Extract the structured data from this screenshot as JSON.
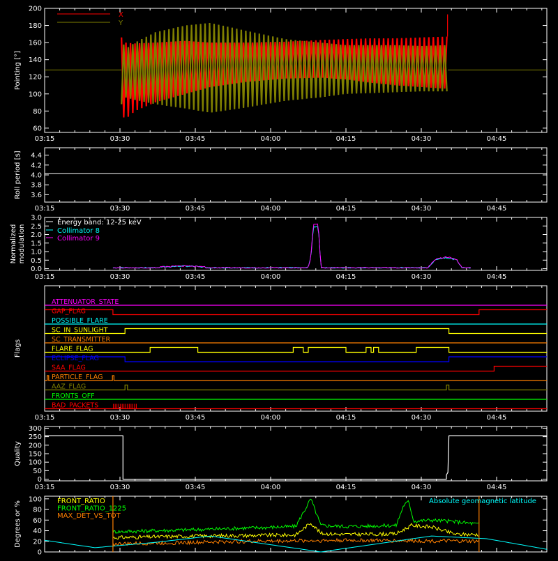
{
  "chart_data": [
    {
      "id": "pointing",
      "type": "line",
      "ylabel": "Pointing [°]",
      "x_tick_labels": [
        "03:15",
        "03:30",
        "03:45",
        "04:00",
        "04:15",
        "04:30",
        "04:45"
      ],
      "ylim": [
        55,
        200
      ],
      "y_tick_labels": [
        "60",
        "80",
        "100",
        "120",
        "140",
        "160",
        "180",
        "200"
      ],
      "baseline": 128,
      "data_window_minutes": [
        15.3,
        80.3
      ],
      "oscillation_period_minutes": 0.9,
      "envelope_x": {
        "minutes": [
          15.3,
          16.0,
          18,
          22,
          28,
          33,
          40,
          48,
          55,
          60,
          65,
          70,
          75,
          80.3
        ],
        "upper": [
          166,
          160,
          159,
          160,
          162,
          160,
          160,
          161,
          163,
          164,
          165,
          165,
          166,
          167
        ],
        "lower": [
          77,
          70,
          80,
          90,
          100,
          108,
          114,
          118,
          119,
          117,
          113,
          110,
          108,
          106
        ]
      },
      "envelope_y": {
        "minutes": [
          15.3,
          16.0,
          18,
          22,
          28,
          33,
          40,
          48,
          55,
          60,
          65,
          70,
          75,
          80.3
        ],
        "upper": [
          168,
          152,
          160,
          172,
          180,
          183,
          174,
          164,
          160,
          157,
          157,
          157,
          156,
          157
        ],
        "lower": [
          88,
          96,
          93,
          88,
          83,
          78,
          84,
          92,
          96,
          100,
          101,
          102,
          103,
          103
        ]
      },
      "series": [
        {
          "name": "X",
          "color": "#ff0000"
        },
        {
          "name": "Y",
          "color": "#808000"
        }
      ]
    },
    {
      "id": "roll",
      "type": "line",
      "ylabel": "Roll period [s]",
      "x_tick_labels": [
        "03:15",
        "03:30",
        "03:45",
        "04:00",
        "04:15",
        "04:30",
        "04:45"
      ],
      "ylim": [
        3.45,
        4.55
      ],
      "y_tick_labels": [
        "3.6",
        "3.8",
        "4.0",
        "4.2",
        "4.4"
      ],
      "value": 4.03,
      "color": "#ffffff"
    },
    {
      "id": "modulation",
      "type": "line",
      "ylabel": "Normalized modulation",
      "x_tick_labels": [
        "03:15",
        "03:30",
        "03:45",
        "04:00",
        "04:15",
        "04:30",
        "04:45"
      ],
      "ylim": [
        -0.1,
        3.0
      ],
      "y_tick_labels": [
        "0.0",
        "0.5",
        "1.0",
        "1.5",
        "2.0",
        "2.5",
        "3.0"
      ],
      "legend_title": "Energy band: 12-25 keV",
      "data_window_minutes": [
        13.6,
        85
      ],
      "series": [
        {
          "name": "Collimator 8",
          "color": "#00ffff"
        },
        {
          "name": "Collimator 9",
          "color": "#ff00ff"
        }
      ],
      "peaks": [
        {
          "minutes": [
            23,
            28,
            32
          ],
          "values": [
            0.06,
            0.12,
            0.06
          ]
        },
        {
          "minutes": [
            52.5,
            53.0,
            53.5,
            54.5,
            55.0
          ],
          "values": [
            0.1,
            0.6,
            2.55,
            2.55,
            0.1
          ]
        },
        {
          "minutes": [
            76.5,
            78,
            80,
            82,
            83
          ],
          "values": [
            0.1,
            0.55,
            0.65,
            0.5,
            0.1
          ]
        }
      ]
    },
    {
      "id": "flags",
      "type": "line",
      "ylabel": "Flags",
      "x_tick_labels": [
        "03:15",
        "03:30",
        "03:45",
        "04:00",
        "04:15",
        "04:30",
        "04:45"
      ],
      "flags": [
        {
          "name": "ATTENUATOR_STATE",
          "color": "#ff00ff",
          "level": [
            [
              0,
              0
            ],
            [
              100,
              0
            ]
          ]
        },
        {
          "name": "GAP_FLAG",
          "color": "#ff0000",
          "level": [
            [
              0,
              1
            ],
            [
              13.6,
              1
            ],
            [
              13.6,
              0
            ],
            [
              86.5,
              0
            ],
            [
              86.5,
              1
            ],
            [
              100,
              1
            ]
          ]
        },
        {
          "name": "POSSIBLE_FLARE",
          "color": "#00ffff",
          "level": [
            [
              0,
              0
            ],
            [
              100,
              0
            ]
          ]
        },
        {
          "name": "SC_IN_SUNLIGHT",
          "color": "#ffff00",
          "level": [
            [
              0,
              0
            ],
            [
              16,
              0
            ],
            [
              16,
              1
            ],
            [
              80.5,
              1
            ],
            [
              80.5,
              0
            ],
            [
              100,
              0
            ]
          ]
        },
        {
          "name": "SC_TRANSMITTER",
          "color": "#ff8000",
          "level": [
            [
              0,
              0
            ],
            [
              100,
              0
            ]
          ]
        },
        {
          "name": "FLARE_FLAG",
          "color": "#ffff00",
          "level": [
            [
              0,
              0
            ],
            [
              21,
              0
            ],
            [
              21,
              1
            ],
            [
              30.5,
              1
            ],
            [
              30.5,
              0
            ],
            [
              49.5,
              0
            ],
            [
              49.5,
              1
            ],
            [
              51.5,
              1
            ],
            [
              51.5,
              0
            ],
            [
              52.5,
              0
            ],
            [
              52.5,
              1
            ],
            [
              60,
              1
            ],
            [
              60,
              0
            ],
            [
              64,
              0
            ],
            [
              64,
              1
            ],
            [
              65,
              1
            ],
            [
              65,
              0
            ],
            [
              65.5,
              0
            ],
            [
              65.5,
              1
            ],
            [
              66.5,
              1
            ],
            [
              66.5,
              0
            ],
            [
              74,
              0
            ],
            [
              74,
              1
            ],
            [
              80.5,
              1
            ],
            [
              80.5,
              0
            ],
            [
              100,
              0
            ]
          ]
        },
        {
          "name": "ECLIPSE_FLAG",
          "color": "#0000ff",
          "level": [
            [
              0,
              1
            ],
            [
              16,
              1
            ],
            [
              16,
              0
            ],
            [
              80.5,
              0
            ],
            [
              80.5,
              1
            ],
            [
              100,
              1
            ]
          ]
        },
        {
          "name": "SAA_FLAG",
          "color": "#ff0000",
          "level": [
            [
              0,
              0
            ],
            [
              89.5,
              0
            ],
            [
              89.5,
              1
            ],
            [
              100,
              1
            ]
          ]
        },
        {
          "name": "PARTICLE_FLAG",
          "color": "#ff8000",
          "level": [
            [
              0,
              0
            ],
            [
              0.5,
              0
            ],
            [
              0.5,
              1
            ],
            [
              0.8,
              1
            ],
            [
              0.8,
              0
            ],
            [
              13.5,
              0
            ],
            [
              13.5,
              1
            ],
            [
              13.8,
              1
            ],
            [
              13.8,
              0
            ],
            [
              100,
              0
            ]
          ]
        },
        {
          "name": "AAZ_FLAG",
          "color": "#808000",
          "level": [
            [
              0,
              0
            ],
            [
              16,
              0
            ],
            [
              16,
              1
            ],
            [
              16.5,
              1
            ],
            [
              16.5,
              0
            ],
            [
              80,
              0
            ],
            [
              80,
              1
            ],
            [
              80.5,
              1
            ],
            [
              80.5,
              0
            ],
            [
              100,
              0
            ]
          ]
        },
        {
          "name": "FRONTS_OFF",
          "color": "#00ff00",
          "level": [
            [
              0,
              0
            ],
            [
              100,
              0
            ]
          ]
        },
        {
          "name": "BAD_PACKETS",
          "color": "#ff0000",
          "level": [
            [
              0,
              0
            ],
            [
              100,
              0
            ]
          ],
          "bursts": [
            [
              13.7,
              18.5
            ]
          ]
        }
      ]
    },
    {
      "id": "quality",
      "type": "line",
      "ylabel": "Quality",
      "x_tick_labels": [
        "03:15",
        "03:30",
        "03:45",
        "04:00",
        "04:15",
        "04:30",
        "04:45"
      ],
      "ylim": [
        -10,
        310
      ],
      "y_tick_labels": [
        "0",
        "50",
        "100",
        "150",
        "200",
        "250",
        "300"
      ],
      "color": "#ffffff",
      "points": [
        [
          0,
          255
        ],
        [
          15.6,
          255
        ],
        [
          15.6,
          0
        ],
        [
          80,
          0
        ],
        [
          80,
          25
        ],
        [
          80.3,
          40
        ],
        [
          80.5,
          255
        ],
        [
          100,
          255
        ]
      ]
    },
    {
      "id": "ratios",
      "type": "line",
      "ylabel": "Degrees or %",
      "ylim": [
        0,
        105
      ],
      "y_tick_labels": [
        "0",
        "20",
        "40",
        "60",
        "80",
        "100"
      ],
      "data_window_minutes": [
        13.6,
        86.5
      ],
      "annotation": "Absolute geomagnetic latitude",
      "annotation_color": "#00ffff",
      "series": [
        {
          "name": "FRONT_RATIO",
          "color": "#ffff00",
          "level_minutes": [
            13.6,
            30,
            50,
            53,
            55,
            60,
            70,
            73,
            77,
            82,
            86.5
          ],
          "level_values": [
            27,
            30,
            32,
            55,
            35,
            33,
            34,
            50,
            47,
            33,
            33
          ]
        },
        {
          "name": "FRONT_RATIO_1225",
          "color": "#00ff00",
          "level_minutes": [
            13.6,
            30,
            50,
            53,
            55,
            60,
            70,
            71.5,
            72.5,
            73.5,
            77,
            82,
            86.5
          ],
          "level_values": [
            38,
            42,
            48,
            100,
            50,
            48,
            50,
            88,
            95,
            58,
            60,
            57,
            52
          ]
        },
        {
          "name": "MAX_DET_VS_TOT",
          "color": "#ff8000",
          "level_minutes": [
            13.6,
            40,
            60,
            86.5
          ],
          "level_values": [
            15,
            20,
            22,
            20
          ]
        },
        {
          "name": "Absolute geomagnetic latitude",
          "color": "#00ffff",
          "curve_minutes": [
            0,
            10,
            22,
            33,
            44,
            55,
            66,
            77,
            88,
            100
          ],
          "curve_values": [
            22,
            8,
            18,
            30,
            15,
            0,
            15,
            30,
            25,
            5
          ]
        }
      ],
      "markers": [
        {
          "minutes": 13.6,
          "color": "#ff8000"
        },
        {
          "minutes": 86.5,
          "color": "#ff8000"
        }
      ]
    }
  ]
}
